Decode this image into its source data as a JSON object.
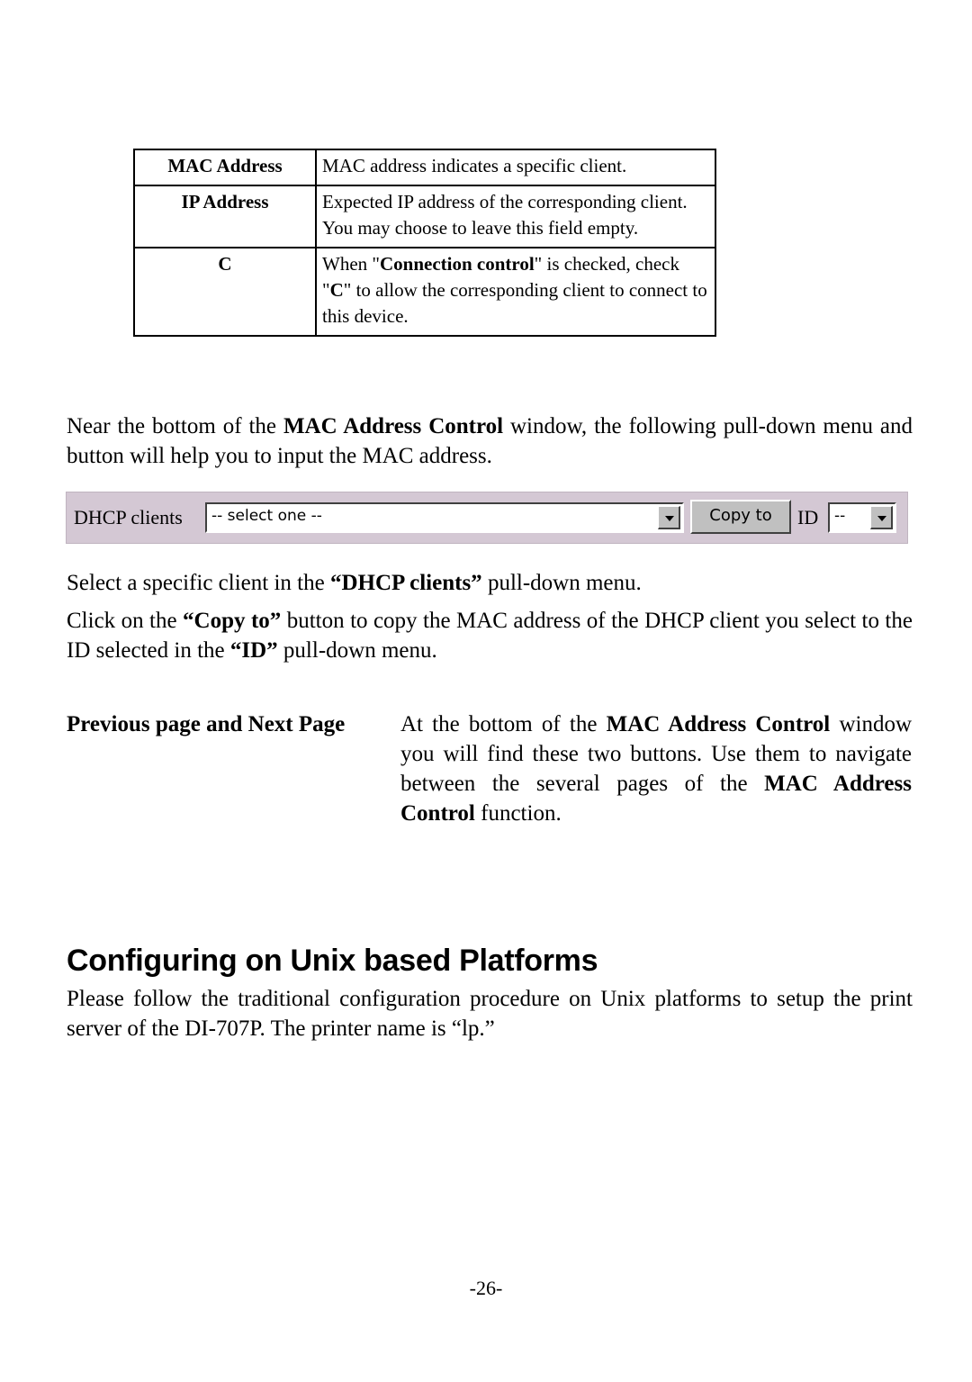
{
  "table": {
    "rows": [
      {
        "term": "MAC Address",
        "desc_parts": [
          "MAC address indicates a specific client."
        ]
      },
      {
        "term": "IP Address",
        "desc_parts": [
          "Expected IP address of the corresponding client. You may choose to leave this field empty."
        ]
      },
      {
        "term": "C",
        "desc_parts": [
          "When \"",
          "Connection control",
          "\" is checked, check \"",
          "C",
          "\" to allow the corresponding client to connect to this device."
        ]
      }
    ]
  },
  "intro": {
    "p1_a": "Near the bottom of the ",
    "p1_b": "MAC Address Control",
    "p1_c": " window, the following pull-down menu and button will help you to input the MAC address."
  },
  "dhcp_widget": {
    "label": "DHCP clients",
    "select_value": "-- select one --",
    "copy_button": "Copy to",
    "id_label": "ID",
    "id_value": "--",
    "background_color": "#d4c8d4"
  },
  "instructions": {
    "p2_a": "Select a specific client in the ",
    "p2_b": "“DHCP clients”",
    "p2_c": " pull-down menu.",
    "p3_a": "Click on the ",
    "p3_b": "“Copy to”",
    "p3_c": " button to copy the MAC address of the DHCP client you select to the ID selected in the ",
    "p3_d": "“ID”",
    "p3_e": " pull-down menu."
  },
  "nav_term": {
    "term": "Previous page and Next Page",
    "desc_a": "At the bottom of the ",
    "desc_b": "MAC Address Control",
    "desc_c": " window you will find these two buttons. Use them to navigate between the several pages of the ",
    "desc_d": "MAC Address Control",
    "desc_e": " function."
  },
  "unix_section": {
    "heading": "Configuring on Unix based Platforms",
    "body": "Please follow the traditional configuration procedure on Unix platforms to setup the print server of the DI-707P. The printer name is “lp.”"
  },
  "footer": {
    "page_number": "-26-"
  }
}
